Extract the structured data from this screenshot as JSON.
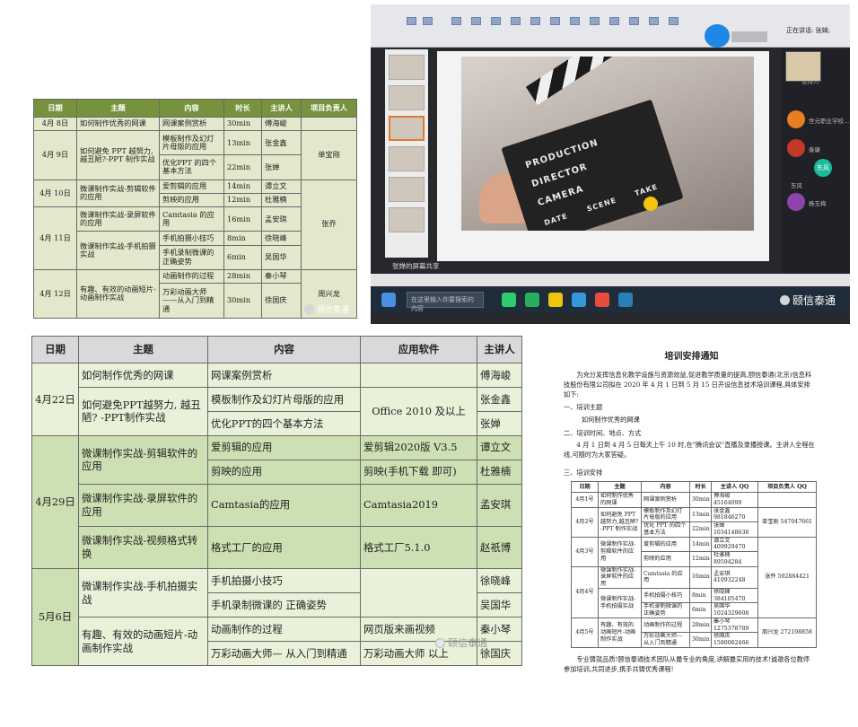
{
  "panel1": {
    "headers": [
      "日期",
      "主题",
      "内容",
      "时长",
      "主讲人",
      "项目负责人"
    ],
    "rows": [
      {
        "date": "4月 8日",
        "topic": "如何制作优秀的网课",
        "content": "网课案例赏析",
        "duration": "30min",
        "speaker": "傅海峻"
      },
      {
        "date": "4月 9日",
        "topic": "如何避免 PPT 越努力,越丑陋?-PPT 制作实战",
        "content": "模板制作及幻灯片母版的应用",
        "duration": "13min",
        "speaker": "张金鑫"
      },
      {
        "content": "优化PPT 的四个基本方法",
        "duration": "22min",
        "speaker": "张婵"
      },
      {
        "date": "4月 10日",
        "topic": "微课制作实战-剪辑软件的应用",
        "content": "爱剪辑的应用",
        "duration": "14min",
        "speaker": "谭立文"
      },
      {
        "content": "剪映的应用",
        "duration": "12min",
        "speaker": "杜雅楠"
      },
      {
        "date": "4月 11日",
        "topic": "微课制作实战-录屏软件的应用",
        "content": "Camtasia 的应用",
        "duration": "16min",
        "speaker": "孟安琪"
      },
      {
        "topic": "微课制作实战-手机拍摄实战",
        "content": "手机拍摄小技巧",
        "duration": "8min",
        "speaker": "徐晓峰"
      },
      {
        "content": "手机录制微课的正确姿势",
        "duration": "6min",
        "speaker": "吴国华"
      },
      {
        "date": "4月 12日",
        "topic": "有趣、有效的动画短片-动画制作实战",
        "content": "动画制作的过程",
        "duration": "28min",
        "speaker": "秦小琴"
      },
      {
        "content": "万彩动画大师——从入门到精通",
        "duration": "30min",
        "speaker": "徐国庆"
      }
    ],
    "leads": [
      "单宝刚",
      "张乔",
      "周兴龙"
    ],
    "watermark": "颐信泰通"
  },
  "panel2": {
    "status": "正在讲话: 张婵;",
    "search_placeholder": "在这里输入你要搜索的内容",
    "share_label": "张婵的屏幕共享",
    "clapper_words": [
      "PRODUCTION",
      "DIRECTOR",
      "CAMERA",
      "DATE",
      "SCENE",
      "TAKE"
    ],
    "participants": [
      "主持人",
      "世元职业学校...",
      "泰康",
      "东风",
      "杨玉梅"
    ],
    "avatar_text": "东风",
    "watermark": "颐信泰通"
  },
  "panel3": {
    "headers": [
      "日期",
      "主题",
      "内容",
      "应用软件",
      "主讲人"
    ],
    "rows": [
      {
        "date": "4月22日",
        "topic": "如何制作优秀的网课",
        "content": "网课案例赏析",
        "speaker": "傅海峻"
      },
      {
        "topic": "如何避免PPT越努力, 越丑陋? -PPT制作实战",
        "content": "模板制作及幻灯片母版的应用",
        "software": "Office 2010 及以上",
        "speaker": "张金鑫"
      },
      {
        "content": "优化PPT的四个基本方法",
        "speaker": "张婵"
      },
      {
        "date": "4月29日",
        "topic": "微课制作实战-剪辑软件的应用",
        "content": "爱剪辑的应用",
        "software": "爱剪辑2020版 V3.5",
        "speaker": "谭立文"
      },
      {
        "content": "剪映的应用",
        "software": "剪映(手机下载 即可)",
        "speaker": "杜雅楠"
      },
      {
        "topic": "微课制作实战-录屏软件的应用",
        "content": "Camtasia的应用",
        "software": "Camtasia2019",
        "speaker": "孟安琪"
      },
      {
        "topic": "微课制作实战-视频格式转换",
        "content": "格式工厂的应用",
        "software": "格式工厂5.1.0",
        "speaker": "赵祇博"
      },
      {
        "date": "5月6日",
        "topic": "微课制作实战-手机拍摄实战",
        "content": "手机拍摄小技巧",
        "speaker": "徐晓峰"
      },
      {
        "content": "手机录制微课的 正确姿势",
        "speaker": "吴国华"
      },
      {
        "topic": "有趣、有效的动画短片-动画制作实战",
        "content": "动画制作的过程",
        "software": "网页版来画视频",
        "speaker": "秦小琴"
      },
      {
        "content": "万彩动画大师— 从入门到精通",
        "software": "万彩动画大师 以上",
        "speaker": "徐国庆"
      }
    ],
    "watermark": "颐信泰通"
  },
  "panel4": {
    "title": "培训安排通知",
    "intro": "为充分发挥信息化教学设施与资源效益,促进教学质量的提高,颐信泰通(北京)信息科技股份有限公司拟在 2020 年 4 月 1 日到 5 月 15 日开设信息技术培训课程,具体安排如下:",
    "sec1": "一、培训主题",
    "sec1_body": "如何制作优秀的网课",
    "sec2": "二、培训时间、地点、方式",
    "sec2_body": "4 月 1 日到 4 月 5 日每天上午 10 时,在\"腾讯会议\"直播及录播授课。主讲人全程在线,可随时为大家答疑。",
    "sec3": "三、培训安排",
    "headers": [
      "日期",
      "主题",
      "内容",
      "时长",
      "主讲人 QQ",
      "项目负责人 QQ"
    ],
    "rows": [
      {
        "date": "4月1号",
        "topic": "如何制作优秀的网课",
        "content": "网课案例赏析",
        "duration": "30min",
        "speaker": "傅海峻 45164099"
      },
      {
        "date": "4月2号",
        "topic": "如何避免 PPT 越努力,越丑陋?-PPT 制作实战",
        "content": "模板制作及幻灯片母版的应用",
        "duration": "13min",
        "speaker": "张金鑫 981846270",
        "lead": "单宝刚 547047661"
      },
      {
        "content": "优化 PPT 的四个基本方法",
        "duration": "22min",
        "speaker": "张婵 1034148638"
      },
      {
        "date": "4月3号",
        "topic": "微课制作实战-剪辑软件的应用",
        "content": "爱剪辑的应用",
        "duration": "14min",
        "speaker": "谭立文 409929470"
      },
      {
        "content": "剪映的应用",
        "duration": "12min",
        "speaker": "杜雅楠 89594284"
      },
      {
        "date": "4月4号",
        "topic": "微课制作实战-录屏软件的应用",
        "content": "Camtasia 的应用",
        "duration": "16min",
        "speaker": "孟安琪 410932248",
        "lead": "张乔 592884421"
      },
      {
        "topic": "微课制作实战-手机拍摄实战",
        "content": "手机拍摄小技巧",
        "duration": "8min",
        "speaker": "徐晓峰 384105470"
      },
      {
        "content": "手机录制微课的正确姿势",
        "duration": "6min",
        "speaker": "吴国华 1024329608"
      },
      {
        "date": "4月5号",
        "topic": "有趣、有效的动画短片-动画制作实战",
        "content": "动画制作的过程",
        "duration": "28min",
        "speaker": "秦小琴 1275378789",
        "lead": "周兴龙 272198858"
      },
      {
        "content": "万彩动画大师—从入门到精通",
        "duration": "30min",
        "speaker": "徐国庆 1580062466"
      }
    ],
    "footer": "专业铸就品质!颐信泰通技术团队从最专业的角度,讲解最实用的技术!诚邀各位教师参加培训,共同进步,携手共铸优秀课程!"
  }
}
